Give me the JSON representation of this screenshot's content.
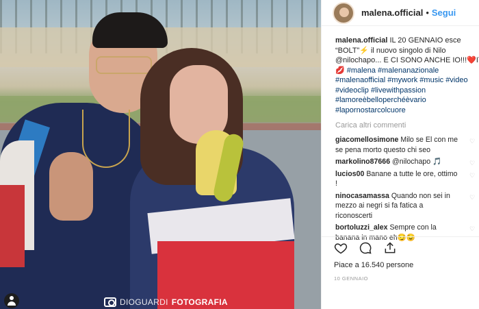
{
  "post": {
    "author": "malena.official",
    "follow_label": "Segui",
    "caption_lines": [
      "IL 20 GENNAIO esce",
      "“BOLT”⚡ il nuovo singolo di Nilo",
      "@nilochapo... E CI SONO ANCHE IO!!!❤️IT",
      "💋 #malena #malenanazionale",
      "#malenaofficial #mywork #music #video",
      "#videoclip #livewithpassion",
      "#lamoreèbelloperchéèvario",
      "#lapornostarcolcuore"
    ],
    "load_more": "Carica altri commenti",
    "likes": "Piace a 16.540 persone",
    "date": "10 GENNAIO"
  },
  "comments": [
    {
      "user": "giacomellosimone",
      "text": "Milo se El con me se pena morto questo chi seo"
    },
    {
      "user": "markolino87666",
      "text": "@nilochapo 🎵"
    },
    {
      "user": "lucios00",
      "text": "Banane a tutte le ore, ottimo !"
    },
    {
      "user": "ninocasamassa",
      "text": "Quando non sei in mezzo ai negri si fa fatica a riconoscerti"
    },
    {
      "user": "bortoluzzi_alex",
      "text": "Sempre con la banana in mano eh😏😉"
    }
  ],
  "watermark": {
    "brand": "DIOGUARDI",
    "suffix": "FOTOGRAFIA"
  },
  "icons": [
    "heart-icon",
    "comment-icon",
    "share-icon",
    "user-tag-icon",
    "avatar-icon"
  ],
  "colors": {
    "link": "#3897f0",
    "hashtag": "#003569",
    "muted": "#999999"
  }
}
